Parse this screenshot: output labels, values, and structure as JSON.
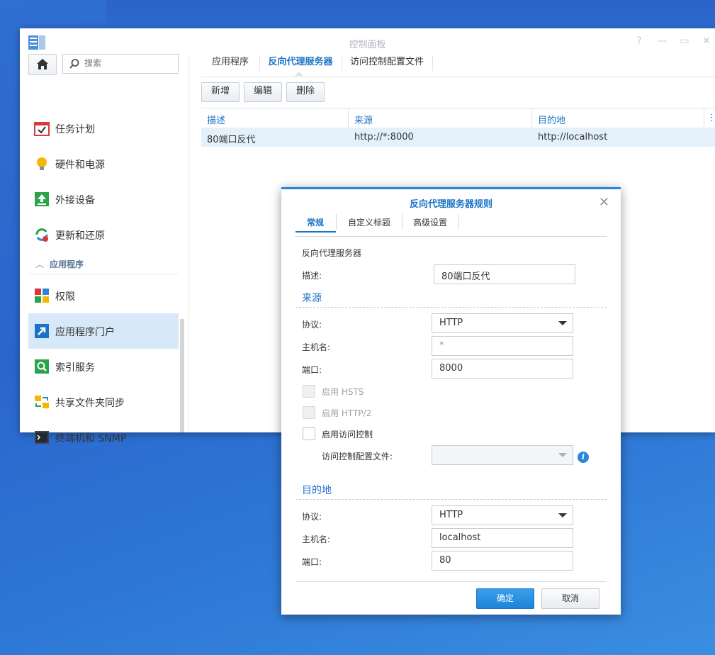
{
  "window": {
    "title": "控制面板"
  },
  "search": {
    "placeholder": "搜索"
  },
  "sidebar": {
    "items_top": [
      {
        "label": "任务计划",
        "icon": "task-scheduler-icon"
      },
      {
        "label": "硬件和电源",
        "icon": "hardware-power-icon"
      },
      {
        "label": "外接设备",
        "icon": "external-devices-icon"
      },
      {
        "label": "更新和还原",
        "icon": "update-restore-icon"
      }
    ],
    "section_label": "应用程序",
    "items_apps": [
      {
        "label": "权限",
        "icon": "privileges-icon"
      },
      {
        "label": "应用程序门户",
        "icon": "application-portal-icon",
        "active": true
      },
      {
        "label": "索引服务",
        "icon": "indexing-service-icon"
      },
      {
        "label": "共享文件夹同步",
        "icon": "shared-folder-sync-icon"
      },
      {
        "label": "终端机和 SNMP",
        "icon": "terminal-snmp-icon"
      }
    ]
  },
  "tabs": [
    {
      "label": "应用程序"
    },
    {
      "label": "反向代理服务器",
      "selected": true
    },
    {
      "label": "访问控制配置文件"
    }
  ],
  "toolbar": {
    "create": "新增",
    "edit": "编辑",
    "delete": "删除"
  },
  "grid": {
    "columns": [
      "描述",
      "来源",
      "目的地"
    ],
    "rows": [
      {
        "description": "80端口反代",
        "source": "http://*:8000",
        "destination": "http://localhost"
      }
    ]
  },
  "dialog": {
    "title": "反向代理服务器规则",
    "tabs": [
      "常规",
      "自定义标题",
      "高级设置"
    ],
    "group_label": "反向代理服务器",
    "description_label": "描述:",
    "description_value": "80端口反代",
    "source": {
      "title": "来源",
      "protocol_label": "协议:",
      "protocol_value": "HTTP",
      "hostname_label": "主机名:",
      "hostname_value": "*",
      "port_label": "端口:",
      "port_value": "8000",
      "hsts_label": "启用 HSTS",
      "http2_label": "启用 HTTP/2",
      "access_control_label": "启用访问控制",
      "access_profile_label": "访问控制配置文件:",
      "access_profile_value": ""
    },
    "destination": {
      "title": "目的地",
      "protocol_label": "协议:",
      "protocol_value": "HTTP",
      "hostname_label": "主机名:",
      "hostname_value": "localhost",
      "port_label": "端口:",
      "port_value": "80"
    },
    "ok_label": "确定",
    "cancel_label": "取消"
  },
  "colors": {
    "accent": "#1a74c6",
    "selection": "#d7e9f8",
    "desktop": "#2f6fd0"
  }
}
